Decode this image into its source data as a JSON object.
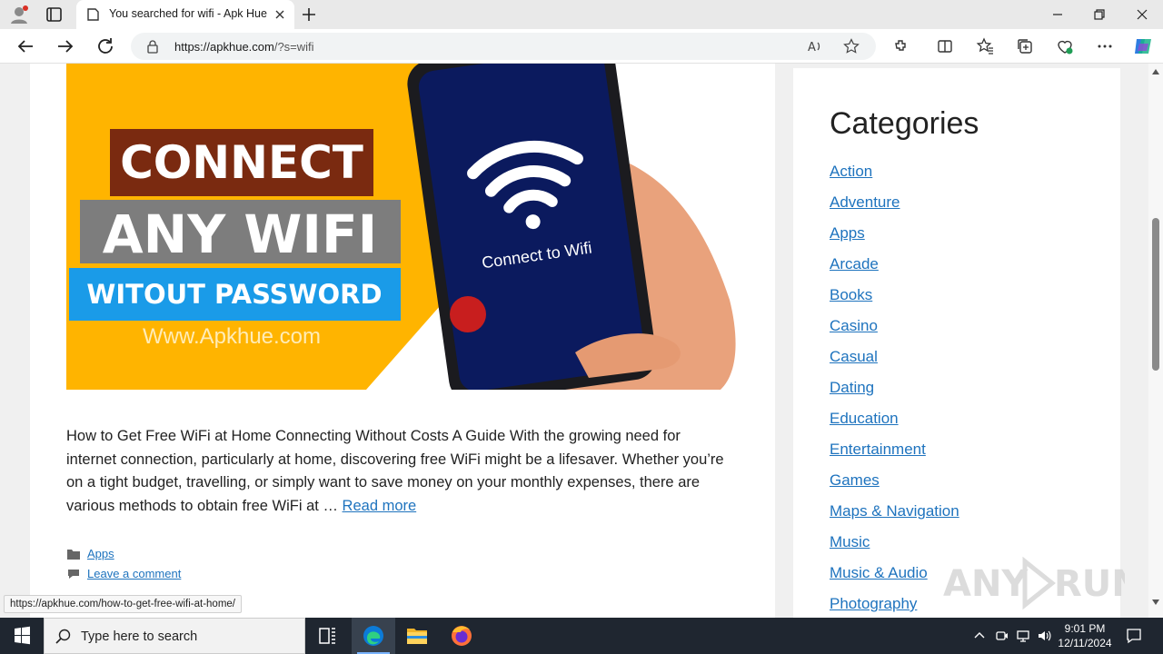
{
  "browser": {
    "tab_title": "You searched for wifi - Apk Hue",
    "url_host": "https://apkhue.com",
    "url_path": "/?s=wifi"
  },
  "hero_image": {
    "line1": "CONNECT",
    "line2": "ANY WIFI",
    "line3": "WITOUT PASSWORD",
    "site": "Www.Apkhue.com",
    "phone_text": "Connect to Wifi",
    "colors": {
      "yellow": "#ffb400",
      "brown": "#7a2a10",
      "gray": "#7d7d7d",
      "blue": "#1a9be8",
      "phone_screen": "#0b1a5e"
    }
  },
  "article": {
    "excerpt": "How to Get Free WiFi at Home Connecting Without Costs A Guide With the growing need for internet connection, particularly at home, discovering free WiFi might be a lifesaver. Whether you’re on a tight budget, travelling, or simply want to save money on your monthly expenses, there are various methods to obtain free WiFi at … ",
    "read_more": "Read more",
    "category_link": "Apps",
    "comment_link": "Leave a comment"
  },
  "sidebar": {
    "heading": "Categories",
    "categories": [
      "Action",
      "Adventure",
      "Apps",
      "Arcade",
      "Books",
      "Casino",
      "Casual",
      "Dating",
      "Education",
      "Entertainment",
      "Games",
      "Maps & Navigation",
      "Music",
      "Music & Audio",
      "Photography"
    ]
  },
  "status_url": "https://apkhue.com/how-to-get-free-wifi-at-home/",
  "watermark": {
    "left": "ANY",
    "right": "RUN"
  },
  "taskbar": {
    "search_placeholder": "Type here to search",
    "time": "9:01 PM",
    "date": "12/11/2024"
  },
  "colors": {
    "link": "#1e73be",
    "taskbar": "#1f2630",
    "edge_accent": "#0078d4"
  }
}
